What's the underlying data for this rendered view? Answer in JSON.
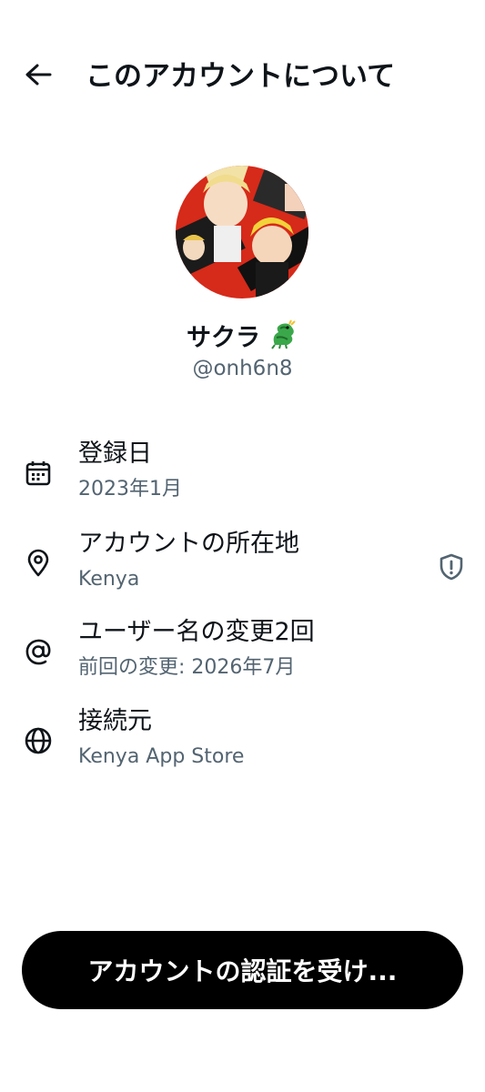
{
  "header": {
    "back_icon": "arrow-left-icon",
    "title": "このアカウントについて"
  },
  "profile": {
    "display_name": "サクラ",
    "name_emoji_icon": "dragon-emoji-icon",
    "handle": "@onh6n8"
  },
  "info_rows": [
    {
      "icon": "calendar-icon",
      "label": "登録日",
      "value": "2023年1月"
    },
    {
      "icon": "location-pin-icon",
      "label": "アカウントの所在地",
      "value": "Kenya",
      "trailing_icon": "shield-info-icon"
    },
    {
      "icon": "at-sign-icon",
      "label": "ユーザー名の変更2回",
      "value": "前回の変更: 2026年7月"
    },
    {
      "icon": "globe-icon",
      "label": "接続元",
      "value": "Kenya App Store"
    }
  ],
  "footer": {
    "verify_label": "アカウントの認証を受け..."
  },
  "colors": {
    "primary_text": "#0f1419",
    "secondary_text": "#536471",
    "button_bg": "#000000",
    "button_text": "#ffffff"
  }
}
